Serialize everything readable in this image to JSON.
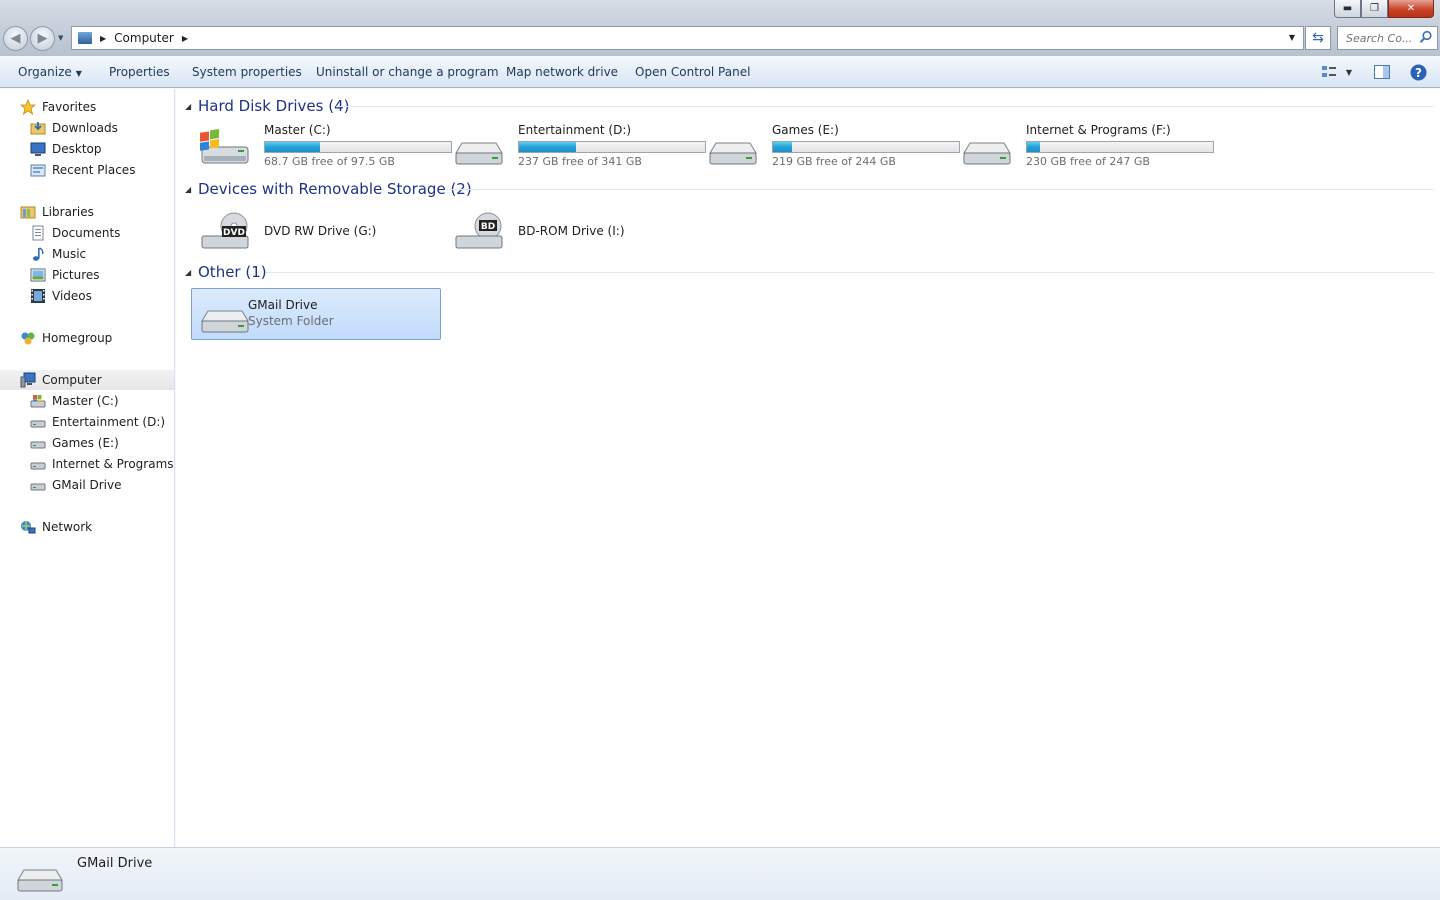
{
  "window": {
    "title": "Computer",
    "controls": {
      "minimize": "minimize-icon",
      "restore": "restore-icon",
      "close": "close-icon"
    }
  },
  "address_bar": {
    "breadcrumbs": [
      "Computer"
    ],
    "search_placeholder": "Search Co..."
  },
  "toolbar": {
    "organize": "Organize",
    "properties": "Properties",
    "system_properties": "System properties",
    "uninstall": "Uninstall or change a program",
    "map_network": "Map network drive",
    "control_panel": "Open Control Panel"
  },
  "nav": {
    "favorites": "Favorites",
    "downloads": "Downloads",
    "desktop": "Desktop",
    "recent_places": "Recent Places",
    "libraries": "Libraries",
    "documents": "Documents",
    "music": "Music",
    "pictures": "Pictures",
    "videos": "Videos",
    "homegroup": "Homegroup",
    "computer": "Computer",
    "drive_c": "Master (C:)",
    "drive_d": "Entertainment (D:)",
    "drive_e": "Games (E:)",
    "drive_f": "Internet & Programs (F:",
    "gmail": "GMail Drive",
    "network": "Network"
  },
  "groups": {
    "hdd": "Hard Disk Drives (4)",
    "removable": "Devices with Removable Storage (2)",
    "other": "Other (1)"
  },
  "drives": [
    {
      "name": "Master (C:)",
      "free_text": "68.7 GB free of 97.5 GB",
      "used_fraction": 0.295
    },
    {
      "name": "Entertainment (D:)",
      "free_text": "237 GB free of 341 GB",
      "used_fraction": 0.305
    },
    {
      "name": "Games (E:)",
      "free_text": "219 GB free of 244 GB",
      "used_fraction": 0.102
    },
    {
      "name": "Internet & Programs (F:)",
      "free_text": "230 GB free of 247 GB",
      "used_fraction": 0.069
    }
  ],
  "removable": [
    {
      "name": "DVD RW Drive (G:)",
      "badge": "DVD"
    },
    {
      "name": "BD-ROM Drive (I:)",
      "badge": "BD"
    }
  ],
  "other": [
    {
      "name": "GMail Drive",
      "subtitle": "System Folder"
    }
  ],
  "details": {
    "name": "GMail Drive"
  },
  "colors": {
    "group_title": "#1e3287",
    "bar_fill": "#26a0da",
    "selection": "#c1dbfc"
  }
}
